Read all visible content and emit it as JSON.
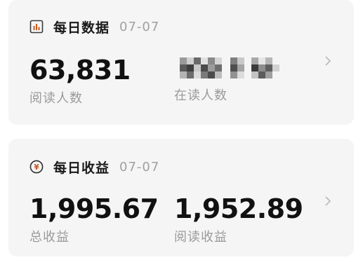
{
  "daily_data": {
    "title": "每日数据",
    "date": "07-07",
    "reads": {
      "value": "63,831",
      "label": "阅读人数"
    },
    "online": {
      "label": "在读人数"
    }
  },
  "daily_income": {
    "title": "每日收益",
    "date": "07-07",
    "total": {
      "value": "1,995.67",
      "label": "总收益"
    },
    "reading": {
      "value": "1,952.89",
      "label": "阅读收益"
    },
    "currency_symbol": "¥"
  },
  "colors": {
    "card_bg": "#f5f5f5",
    "chart_icon": "#c65a1e",
    "coin_icon": "#c65a1e",
    "label": "#9a9a9a",
    "date": "#a0a0a0"
  },
  "icons": {
    "daily_data": "bar-chart-icon",
    "daily_income": "yuan-coin-icon",
    "more": "chevron-right-icon"
  }
}
